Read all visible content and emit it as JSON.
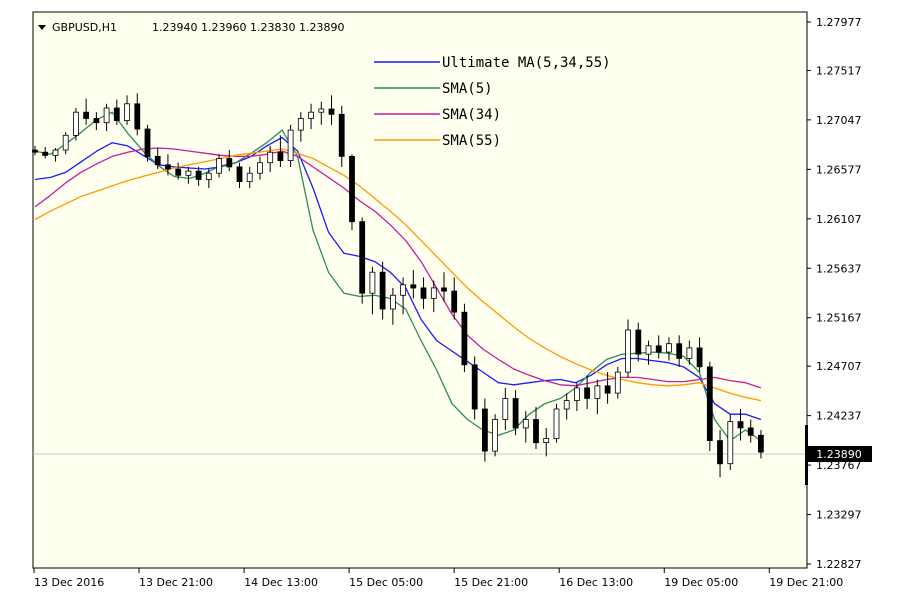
{
  "chart_data": {
    "type": "candlestick",
    "title": "GBPUSD,H1",
    "ohlc_header": [
      "1.23940",
      "1.23960",
      "1.23830",
      "1.23890"
    ],
    "x_tick_labels": [
      "13 Dec 2016",
      "13 Dec 21:00",
      "14 Dec 13:00",
      "15 Dec 05:00",
      "15 Dec 21:00",
      "16 Dec 13:00",
      "19 Dec 05:00",
      "19 Dec 21:00"
    ],
    "y_tick_labels": [
      "1.27977",
      "1.27517",
      "1.27047",
      "1.26577",
      "1.26107",
      "1.25637",
      "1.25167",
      "1.24707",
      "1.24237",
      "1.23767",
      "1.23297",
      "1.22827"
    ],
    "ylim": [
      1.22827,
      1.27977
    ],
    "current_price": 1.2389,
    "current_price_label": "1.23890",
    "legend": [
      {
        "name": "Ultimate MA(5,34,55)",
        "color": "#1a1aff"
      },
      {
        "name": "SMA(5)",
        "color": "#2e8b57"
      },
      {
        "name": "SMA(34)",
        "color": "#cc1a99"
      },
      {
        "name": "SMA(55)",
        "color": "#ff9900"
      }
    ],
    "series": [
      {
        "name": "Ultimate MA(5,34,55)",
        "color": "#1a1aff",
        "values": [
          1.2648,
          1.265,
          1.2655,
          1.2665,
          1.2675,
          1.2683,
          1.268,
          1.2671,
          1.2662,
          1.266,
          1.2659,
          1.2658,
          1.266,
          1.2664,
          1.267,
          1.268,
          1.2688,
          1.2675,
          1.264,
          1.2598,
          1.2578,
          1.2575,
          1.257,
          1.256,
          1.2545,
          1.2515,
          1.2495,
          1.2485,
          1.2475,
          1.2465,
          1.2455,
          1.2453,
          1.2455,
          1.2457,
          1.2458,
          1.2455,
          1.2462,
          1.2472,
          1.2478,
          1.2478,
          1.2476,
          1.2474,
          1.247,
          1.246,
          1.2435,
          1.2425,
          1.2425,
          1.242
        ]
      },
      {
        "name": "SMA(5)",
        "color": "#2e8b57",
        "values": [
          1.2675,
          1.2672,
          1.2682,
          1.2693,
          1.2705,
          1.2712,
          1.2692,
          1.2675,
          1.2661,
          1.2651,
          1.2649,
          1.2654,
          1.2661,
          1.2664,
          1.2673,
          1.2683,
          1.2695,
          1.267,
          1.26,
          1.256,
          1.254,
          1.2537,
          1.2538,
          1.2535,
          1.2525,
          1.2495,
          1.2467,
          1.2435,
          1.242,
          1.241,
          1.2405,
          1.241,
          1.2425,
          1.2435,
          1.244,
          1.245,
          1.2465,
          1.2477,
          1.2482,
          1.2483,
          1.2484,
          1.2483,
          1.248,
          1.2465,
          1.242,
          1.24,
          1.241,
          1.24
        ]
      },
      {
        "name": "SMA(34)",
        "color": "#cc1a99",
        "values": [
          1.2622,
          1.2633,
          1.2645,
          1.2655,
          1.2663,
          1.267,
          1.2674,
          1.2677,
          1.2678,
          1.2677,
          1.2675,
          1.2673,
          1.2671,
          1.267,
          1.267,
          1.2672,
          1.2675,
          1.267,
          1.266,
          1.265,
          1.264,
          1.2628,
          1.2618,
          1.2605,
          1.259,
          1.257,
          1.2545,
          1.252,
          1.25,
          1.2487,
          1.2477,
          1.2468,
          1.2462,
          1.2457,
          1.2453,
          1.2452,
          1.2455,
          1.2458,
          1.246,
          1.246,
          1.2458,
          1.2456,
          1.2456,
          1.2458,
          1.246,
          1.2457,
          1.2455,
          1.245
        ]
      },
      {
        "name": "SMA(55)",
        "color": "#ff9900",
        "values": [
          1.261,
          1.2618,
          1.2625,
          1.2632,
          1.2637,
          1.2642,
          1.2647,
          1.2651,
          1.2655,
          1.2659,
          1.2662,
          1.2665,
          1.2668,
          1.2671,
          1.2673,
          1.2675,
          1.2677,
          1.2673,
          1.2668,
          1.266,
          1.2652,
          1.2642,
          1.263,
          1.2618,
          1.2605,
          1.259,
          1.2575,
          1.256,
          1.2545,
          1.2532,
          1.252,
          1.2508,
          1.2497,
          1.2488,
          1.248,
          1.2473,
          1.2467,
          1.2462,
          1.2458,
          1.2455,
          1.2453,
          1.2452,
          1.2453,
          1.2455,
          1.245,
          1.2445,
          1.2441,
          1.2438
        ]
      }
    ],
    "candles": [
      [
        1.2676,
        1.268,
        1.2671,
        1.2674
      ],
      [
        1.2674,
        1.2679,
        1.2668,
        1.2671
      ],
      [
        1.2671,
        1.2678,
        1.2665,
        1.2676
      ],
      [
        1.2676,
        1.2693,
        1.2672,
        1.269
      ],
      [
        1.269,
        1.2716,
        1.2685,
        1.2712
      ],
      [
        1.2712,
        1.2725,
        1.27,
        1.2706
      ],
      [
        1.2706,
        1.2712,
        1.2695,
        1.2702
      ],
      [
        1.2702,
        1.272,
        1.2694,
        1.2716
      ],
      [
        1.2716,
        1.2724,
        1.27,
        1.2704
      ],
      [
        1.2704,
        1.2728,
        1.27,
        1.272
      ],
      [
        1.272,
        1.273,
        1.269,
        1.2696
      ],
      [
        1.2696,
        1.27,
        1.2665,
        1.267
      ],
      [
        1.267,
        1.2678,
        1.2658,
        1.2662
      ],
      [
        1.2662,
        1.2672,
        1.2652,
        1.2658
      ],
      [
        1.2658,
        1.2664,
        1.2648,
        1.2652
      ],
      [
        1.2652,
        1.266,
        1.2644,
        1.2656
      ],
      [
        1.2656,
        1.266,
        1.2642,
        1.2648
      ],
      [
        1.2648,
        1.2658,
        1.264,
        1.2654
      ],
      [
        1.2654,
        1.2672,
        1.265,
        1.2668
      ],
      [
        1.2668,
        1.2676,
        1.2656,
        1.266
      ],
      [
        1.266,
        1.2664,
        1.264,
        1.2646
      ],
      [
        1.2646,
        1.266,
        1.264,
        1.2654
      ],
      [
        1.2654,
        1.267,
        1.2648,
        1.2664
      ],
      [
        1.2664,
        1.268,
        1.2655,
        1.2674
      ],
      [
        1.2674,
        1.269,
        1.266,
        1.2666
      ],
      [
        1.2666,
        1.27,
        1.266,
        1.2695
      ],
      [
        1.2695,
        1.2712,
        1.2684,
        1.2706
      ],
      [
        1.2706,
        1.272,
        1.2696,
        1.2712
      ],
      [
        1.2712,
        1.2722,
        1.27,
        1.2715
      ],
      [
        1.2715,
        1.2728,
        1.27,
        1.271
      ],
      [
        1.271,
        1.2718,
        1.266,
        1.267
      ],
      [
        1.267,
        1.2672,
        1.26,
        1.2608
      ],
      [
        1.2608,
        1.2612,
        1.253,
        1.254
      ],
      [
        1.254,
        1.2565,
        1.252,
        1.256
      ],
      [
        1.256,
        1.257,
        1.2515,
        1.2525
      ],
      [
        1.2525,
        1.2545,
        1.251,
        1.2538
      ],
      [
        1.2538,
        1.2555,
        1.252,
        1.2548
      ],
      [
        1.2548,
        1.2562,
        1.2535,
        1.2545
      ],
      [
        1.2545,
        1.2555,
        1.2525,
        1.2535
      ],
      [
        1.2535,
        1.2552,
        1.2522,
        1.2545
      ],
      [
        1.2545,
        1.256,
        1.2532,
        1.2542
      ],
      [
        1.2542,
        1.2555,
        1.2515,
        1.2522
      ],
      [
        1.2522,
        1.253,
        1.2465,
        1.2472
      ],
      [
        1.2472,
        1.248,
        1.242,
        1.243
      ],
      [
        1.243,
        1.244,
        1.238,
        1.239
      ],
      [
        1.239,
        1.2425,
        1.2385,
        1.242
      ],
      [
        1.242,
        1.245,
        1.241,
        1.244
      ],
      [
        1.244,
        1.2448,
        1.2405,
        1.2412
      ],
      [
        1.2412,
        1.2428,
        1.2398,
        1.242
      ],
      [
        1.242,
        1.2432,
        1.2392,
        1.2398
      ],
      [
        1.2398,
        1.2412,
        1.2385,
        1.2402
      ],
      [
        1.2402,
        1.2435,
        1.2398,
        1.243
      ],
      [
        1.243,
        1.2445,
        1.242,
        1.2438
      ],
      [
        1.2438,
        1.2455,
        1.2428,
        1.245
      ],
      [
        1.245,
        1.2462,
        1.243,
        1.244
      ],
      [
        1.244,
        1.2458,
        1.2425,
        1.2452
      ],
      [
        1.2452,
        1.2465,
        1.2435,
        1.2445
      ],
      [
        1.2445,
        1.247,
        1.244,
        1.2465
      ],
      [
        1.2465,
        1.2515,
        1.246,
        1.2505
      ],
      [
        1.2505,
        1.2512,
        1.2475,
        1.2482
      ],
      [
        1.2482,
        1.2495,
        1.2472,
        1.249
      ],
      [
        1.249,
        1.25,
        1.2478,
        1.2484
      ],
      [
        1.2484,
        1.2498,
        1.2476,
        1.2492
      ],
      [
        1.2492,
        1.25,
        1.247,
        1.2478
      ],
      [
        1.2478,
        1.2495,
        1.2472,
        1.2488
      ],
      [
        1.2488,
        1.2498,
        1.2465,
        1.247
      ],
      [
        1.247,
        1.2475,
        1.239,
        1.24
      ],
      [
        1.24,
        1.241,
        1.2365,
        1.2378
      ],
      [
        1.2378,
        1.2425,
        1.2372,
        1.2418
      ],
      [
        1.2418,
        1.243,
        1.24,
        1.2412
      ],
      [
        1.2412,
        1.242,
        1.2398,
        1.2405
      ],
      [
        1.2405,
        1.241,
        1.2383,
        1.2389
      ]
    ]
  }
}
